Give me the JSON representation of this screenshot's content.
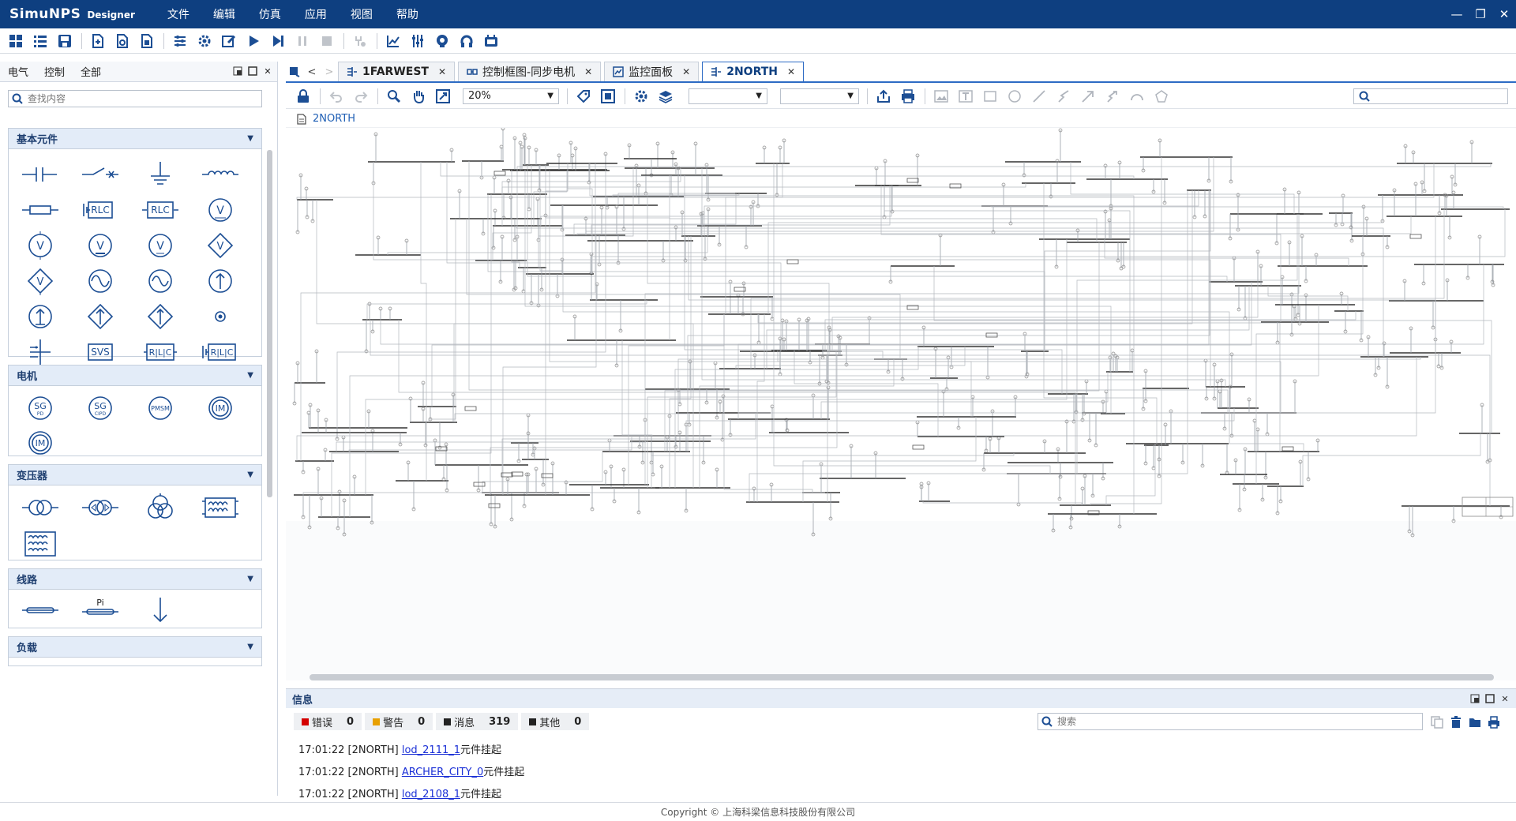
{
  "app": {
    "name": "SimuNPS",
    "edition": "Designer"
  },
  "menu": [
    "文件",
    "编辑",
    "仿真",
    "应用",
    "视图",
    "帮助"
  ],
  "window_controls": [
    "—",
    "❐",
    "✕"
  ],
  "left_panel": {
    "tabs": [
      "电气",
      "控制",
      "全部"
    ],
    "search_placeholder": "查找内容",
    "categories": {
      "basic": "基本元件",
      "motor": "电机",
      "transformer": "变压器",
      "line": "线路",
      "load": "负载"
    },
    "labels": {
      "rlc": "RLC",
      "v": "V",
      "svs": "SVS",
      "sg_pd": [
        "SG",
        "PD"
      ],
      "sg_cipd": [
        "SG",
        "CIPD"
      ],
      "pmsm": "PMSM",
      "im": "IM",
      "pi": "Pi"
    }
  },
  "doc_tabs": [
    {
      "label": "1FARWEST",
      "active": false
    },
    {
      "label": "控制框图-同步电机",
      "active": false
    },
    {
      "label": "监控面板",
      "active": false
    },
    {
      "label": "2NORTH",
      "active": true
    }
  ],
  "canvas_toolbar": {
    "zoom": "20%",
    "dropdown1": "",
    "dropdown2": "",
    "search": ""
  },
  "breadcrumb": "2NORTH",
  "info_panel": {
    "title": "信息",
    "filters": [
      {
        "label": "错误",
        "count": "0",
        "color": "#d40000"
      },
      {
        "label": "警告",
        "count": "0",
        "color": "#e8a000"
      },
      {
        "label": "消息",
        "count": "319",
        "color": "#222222"
      },
      {
        "label": "其他",
        "count": "0",
        "color": "#222222"
      }
    ],
    "search_placeholder": "搜索",
    "messages": [
      {
        "prefix": "17:01:22 [2NORTH] ",
        "link": "lod_2111_1",
        "suffix": "元件挂起"
      },
      {
        "prefix": "17:01:22 [2NORTH] ",
        "link": "ARCHER_CITY_0",
        "suffix": "元件挂起"
      },
      {
        "prefix": "17:01:22 [2NORTH] ",
        "link": "lod_2108_1",
        "suffix": "元件挂起"
      }
    ]
  },
  "footer": "Copyright © 上海科梁信息科技股份有限公司",
  "colors": {
    "titlebar": "#0e3f80",
    "accent": "#2d6bc4",
    "icon_blue": "#1c4e94"
  }
}
